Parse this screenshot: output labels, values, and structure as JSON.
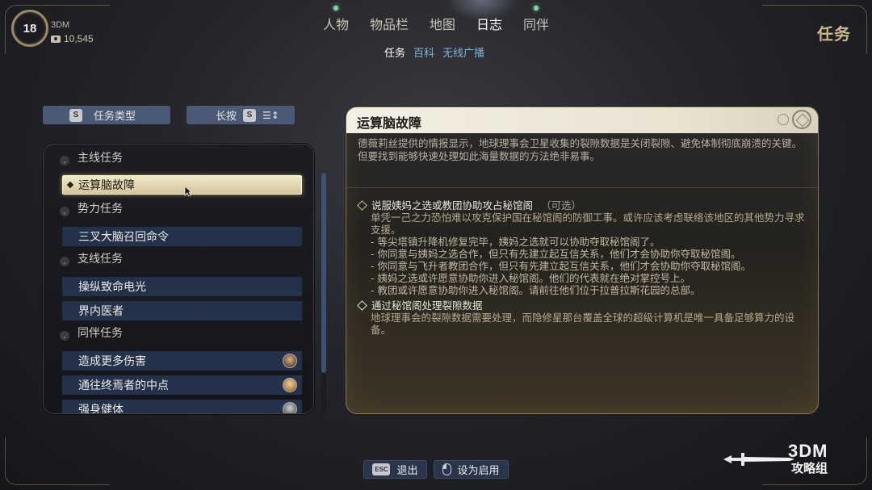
{
  "player": {
    "level": "18",
    "name": "3DM",
    "money": "10,545"
  },
  "top_nav": {
    "items": [
      {
        "label": "人物",
        "notify": true,
        "active": false
      },
      {
        "label": "物品栏",
        "notify": false,
        "active": false
      },
      {
        "label": "地图",
        "notify": false,
        "active": false
      },
      {
        "label": "日志",
        "notify": false,
        "active": true
      },
      {
        "label": "同伴",
        "notify": true,
        "active": false
      }
    ]
  },
  "sub_nav": {
    "items": [
      "任务",
      "百科",
      "无线广播"
    ],
    "active": "任务"
  },
  "section_title": "任务",
  "filters": {
    "type_key": "S",
    "type_label": "任务类型",
    "sort_prefix": "长按",
    "sort_key": "S"
  },
  "quest_list": {
    "categories": [
      {
        "label": "主线任务",
        "quests": [
          {
            "label": "运算脑故障",
            "selected": true
          }
        ]
      },
      {
        "label": "势力任务",
        "quests": [
          {
            "label": "三叉大脑召回命令"
          }
        ]
      },
      {
        "label": "支线任务",
        "quests": [
          {
            "label": "操纵致命电光"
          },
          {
            "label": "界内医者"
          }
        ]
      },
      {
        "label": "同伴任务",
        "quests": [
          {
            "label": "造成更多伤害",
            "portrait": "companion-portrait"
          },
          {
            "label": "通往终焉者的中点",
            "portrait": "companion-portrait"
          },
          {
            "label": "强身健体",
            "portrait": "companion-portrait"
          }
        ]
      }
    ]
  },
  "detail": {
    "title": "运算脑故障",
    "description": "德薇莉丝提供的情报显示，地球理事会卫星收集的裂隙数据是关闭裂隙、避免体制彻底崩溃的关键。但要找到能够快速处理如此海量数据的方法绝非易事。",
    "objectives": [
      {
        "title": "说服姨妈之选或教团协助攻占秘馆阁",
        "optional": "（可选）",
        "body": "单凭一己之力恐怕难以攻克保护国在秘馆阁的防御工事。或许应该考虑联络该地区的其他势力寻求支援。",
        "steps": [
          "- 等尖塔镇升降机修复完毕，姨妈之选就可以协助夺取秘馆阁了。",
          "- 你同意与姨妈之选合作，但只有先建立起互信关系，他们才会协助你夺取秘馆阁。",
          "- 你同意与飞升者教团合作，但只有先建立起互信关系，他们才会协助你夺取秘馆阁。",
          "- 姨妈之选或许愿意协助你进入秘馆阁。他们的代表就在绝对掌控号上。",
          "- 教团或许愿意协助你进入秘馆阁。请前往他们位于拉普拉斯花园的总部。"
        ]
      },
      {
        "title": "通过秘馆阁处理裂隙数据",
        "body": "地球理事会的裂隙数据需要处理，而隐修星那台覆盖全球的超级计算机是唯一具备足够算力的设备。"
      }
    ]
  },
  "bottom": {
    "esc_key": "ESC",
    "exit_label": "退出",
    "activate_label": "设为启用"
  },
  "watermark": {
    "line1": "3DM",
    "line2": "攻略组"
  },
  "colors": {
    "accent_gold": "#c9b88e",
    "selected_bg": "#e6dbb6",
    "row_bg": "#23324a",
    "notify_dot": "#7fd9a6",
    "sub_nav_blue": "#7fb4d9"
  }
}
